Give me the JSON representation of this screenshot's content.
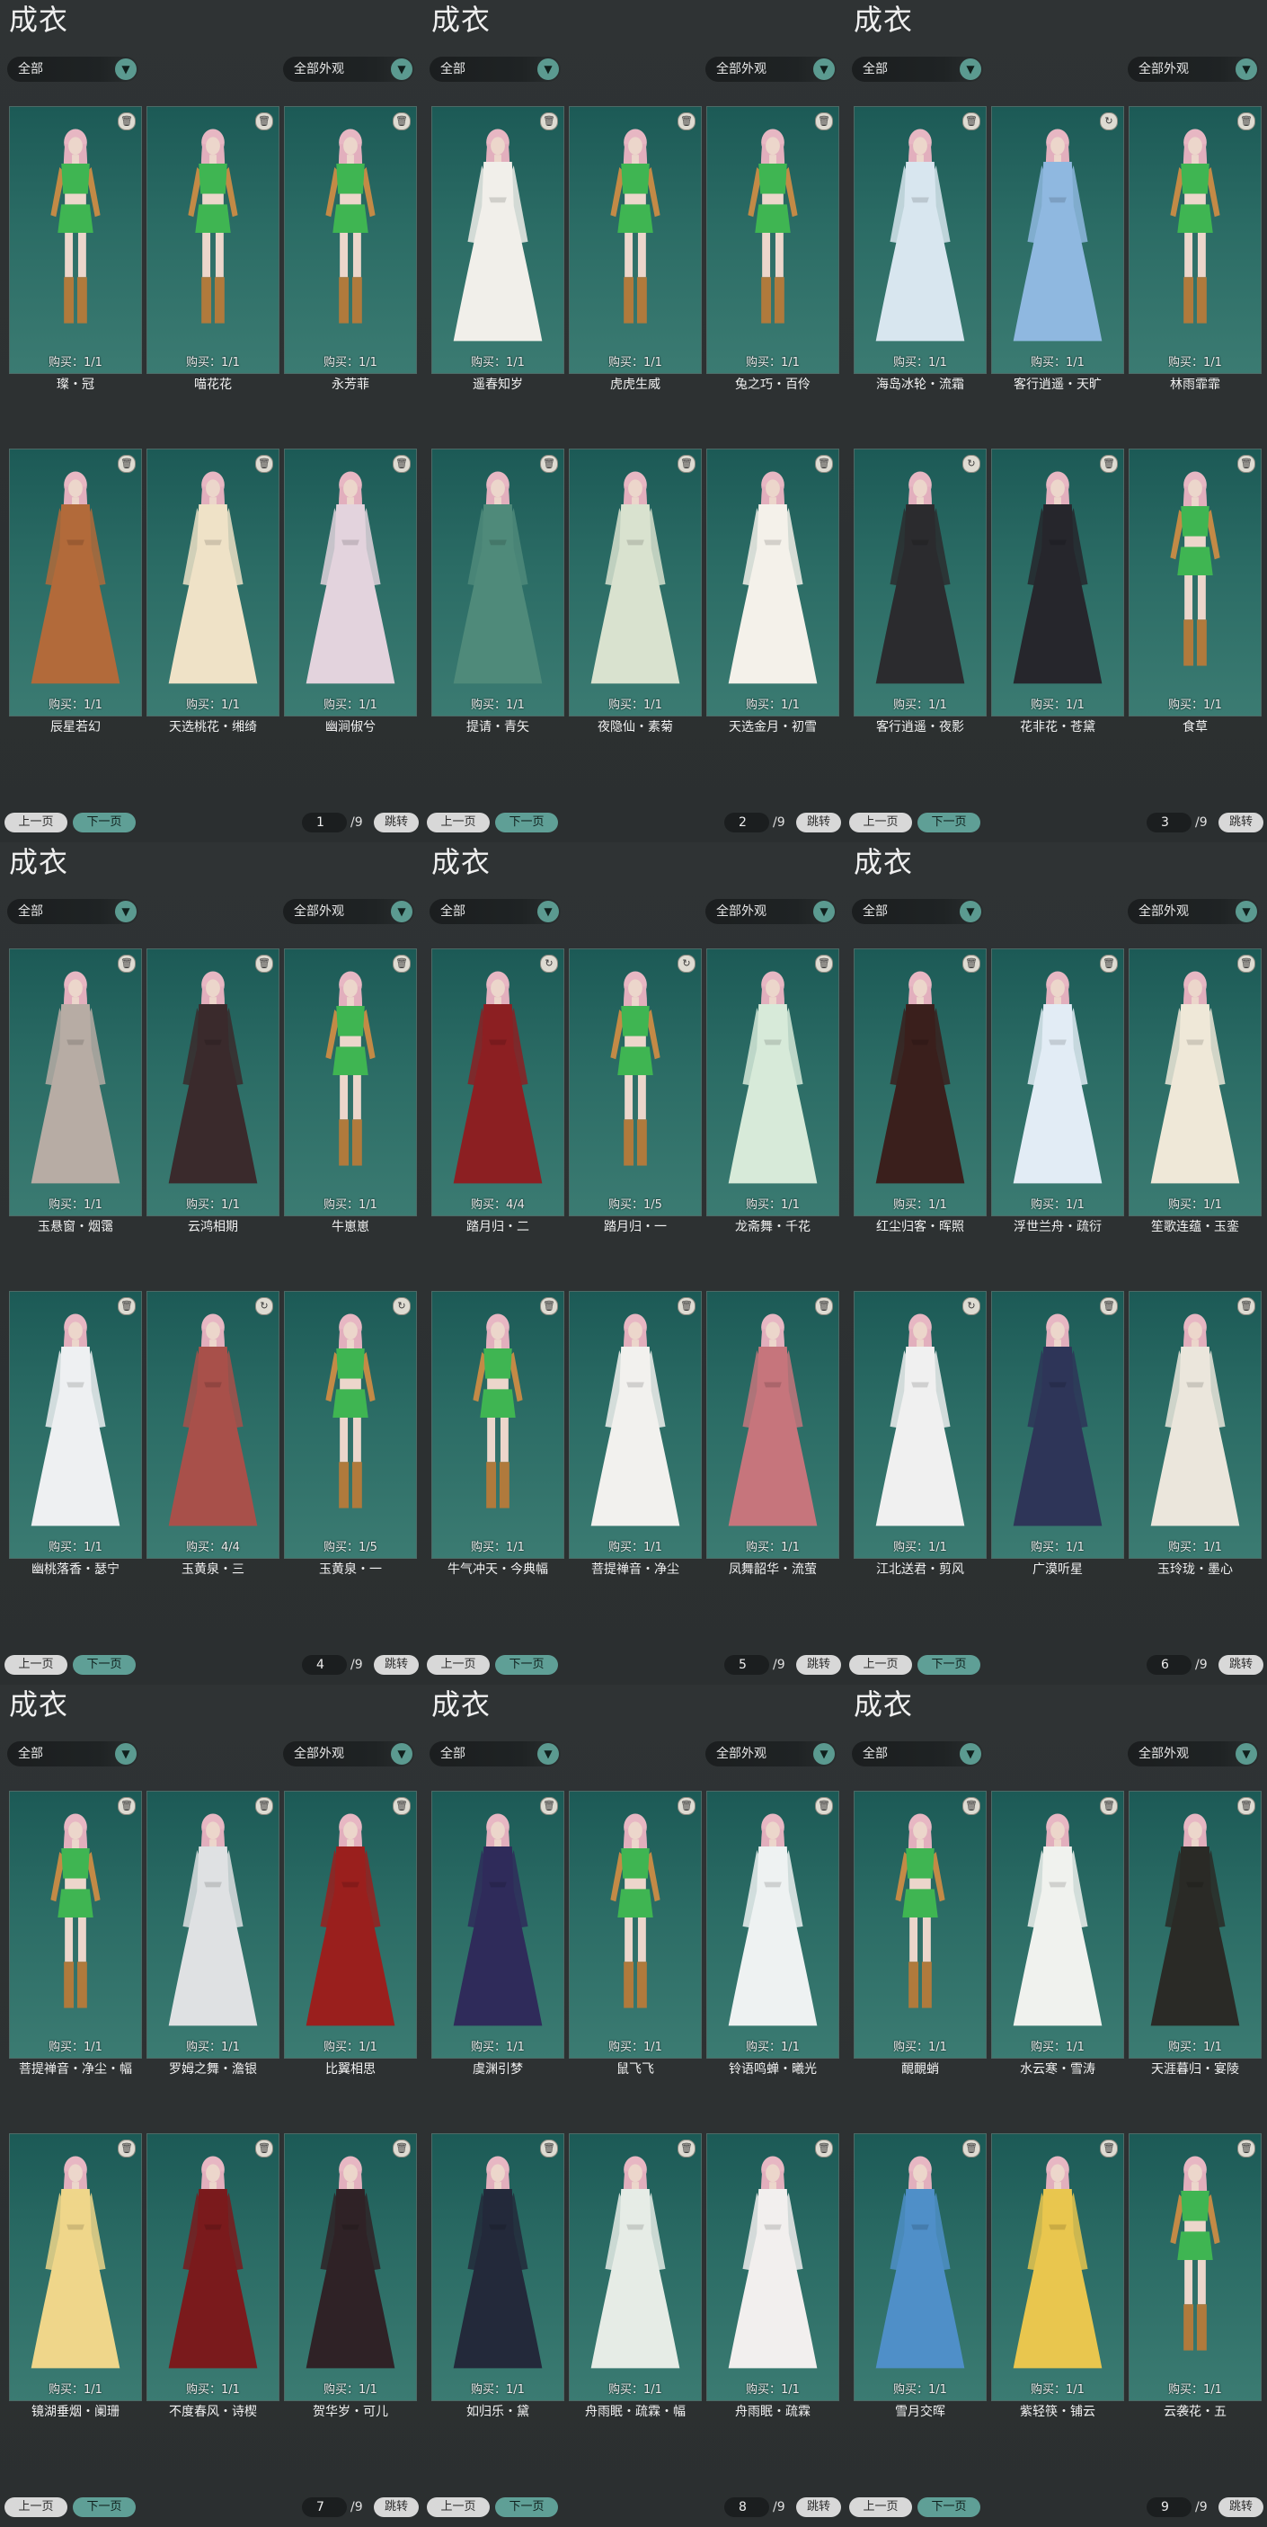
{
  "panels": [
    {
      "title": "成衣",
      "filter1": "全部",
      "filter2": "全部外观",
      "prev": "上一页",
      "next": "下一页",
      "page": "1",
      "total": "/9",
      "jump": "跳转",
      "items": [
        {
          "name": "璨・冠",
          "buy": "购买：1/1",
          "outfit": "green",
          "badge": "trash"
        },
        {
          "name": "喵花花",
          "buy": "购买：1/1",
          "outfit": "green",
          "badge": "trash"
        },
        {
          "name": "永芳菲",
          "buy": "购买：1/1",
          "outfit": "green",
          "badge": "trash"
        },
        {
          "name": "辰星若幻",
          "buy": "购买：1/1",
          "outfit": "#b26a3a",
          "badge": "trash"
        },
        {
          "name": "天选桃花・缃绮",
          "buy": "购买：1/1",
          "outfit": "#efe2c7",
          "badge": "trash"
        },
        {
          "name": "幽涧俶兮",
          "buy": "购买：1/1",
          "outfit": "#e3d3dd",
          "badge": "trash"
        }
      ]
    },
    {
      "title": "成衣",
      "filter1": "全部",
      "filter2": "全部外观",
      "prev": "上一页",
      "next": "下一页",
      "page": "2",
      "total": "/9",
      "jump": "跳转",
      "items": [
        {
          "name": "遥春知岁",
          "buy": "购买：1/1",
          "outfit": "#f1efea",
          "badge": "trash"
        },
        {
          "name": "虎虎生威",
          "buy": "购买：1/1",
          "outfit": "green",
          "badge": "trash"
        },
        {
          "name": "兔之巧・百伶",
          "buy": "购买：1/1",
          "outfit": "green",
          "badge": "trash"
        },
        {
          "name": "提请・青矢",
          "buy": "购买：1/1",
          "outfit": "#4f8a7a",
          "badge": "trash"
        },
        {
          "name": "夜隐仙・素菊",
          "buy": "购买：1/1",
          "outfit": "#d9e2cf",
          "badge": "trash"
        },
        {
          "name": "天选金月・初雪",
          "buy": "购买：1/1",
          "outfit": "#f4f1ea",
          "badge": "trash"
        }
      ]
    },
    {
      "title": "成衣",
      "filter1": "全部",
      "filter2": "全部外观",
      "prev": "上一页",
      "next": "下一页",
      "page": "3",
      "total": "/9",
      "jump": "跳转",
      "items": [
        {
          "name": "海岛冰轮・流霜",
          "buy": "购买：1/1",
          "outfit": "#d8e6ef",
          "badge": "trash"
        },
        {
          "name": "客行逍遥・天旷",
          "buy": "购买：1/1",
          "outfit": "#8fb8e0",
          "badge": "cycle"
        },
        {
          "name": "林雨霏霏",
          "buy": "购买：1/1",
          "outfit": "green",
          "badge": "trash"
        },
        {
          "name": "客行逍遥・夜影",
          "buy": "购买：1/1",
          "outfit": "#2b2b2e",
          "badge": "cycle"
        },
        {
          "name": "花非花・苍黛",
          "buy": "购买：1/1",
          "outfit": "#26262c",
          "badge": "trash"
        },
        {
          "name": "食草",
          "buy": "购买：1/1",
          "outfit": "green",
          "badge": "trash"
        }
      ]
    },
    {
      "title": "成衣",
      "filter1": "全部",
      "filter2": "全部外观",
      "prev": "上一页",
      "next": "下一页",
      "page": "4",
      "total": "/9",
      "jump": "跳转",
      "items": [
        {
          "name": "玉悬窗・烟霭",
          "buy": "购买：1/1",
          "outfit": "#b7aca4",
          "badge": "trash"
        },
        {
          "name": "云鸿相期",
          "buy": "购买：1/1",
          "outfit": "#3a2a2c",
          "badge": "trash"
        },
        {
          "name": "牛崽崽",
          "buy": "购买：1/1",
          "outfit": "green",
          "badge": "trash"
        },
        {
          "name": "幽桃落香・瑟宁",
          "buy": "购买：1/1",
          "outfit": "#eef0f2",
          "badge": "trash"
        },
        {
          "name": "玉黄泉・三",
          "buy": "购买：4/4",
          "outfit": "#a8504a",
          "badge": "cycle"
        },
        {
          "name": "玉黄泉・一",
          "buy": "购买：1/5",
          "outfit": "green",
          "badge": "cycle"
        }
      ]
    },
    {
      "title": "成衣",
      "filter1": "全部",
      "filter2": "全部外观",
      "prev": "上一页",
      "next": "下一页",
      "page": "5",
      "total": "/9",
      "jump": "跳转",
      "items": [
        {
          "name": "踏月归・二",
          "buy": "购买：4/4",
          "outfit": "#8c1f22",
          "badge": "cycle"
        },
        {
          "name": "踏月归・一",
          "buy": "购买：1/5",
          "outfit": "green",
          "badge": "cycle"
        },
        {
          "name": "龙斋舞・千花",
          "buy": "购买：1/1",
          "outfit": "#d7ead9",
          "badge": "trash"
        },
        {
          "name": "牛气冲天・今典幅",
          "buy": "购买：1/1",
          "outfit": "green",
          "badge": "trash"
        },
        {
          "name": "菩提禅音・净尘",
          "buy": "购买：1/1",
          "outfit": "#f2f1ee",
          "badge": "trash"
        },
        {
          "name": "凤舞韶华・流萤",
          "buy": "购买：1/1",
          "outfit": "#c6757c",
          "badge": "trash"
        }
      ]
    },
    {
      "title": "成衣",
      "filter1": "全部",
      "filter2": "全部外观",
      "prev": "上一页",
      "next": "下一页",
      "page": "6",
      "total": "/9",
      "jump": "跳转",
      "items": [
        {
          "name": "红尘归客・晖照",
          "buy": "购买：1/1",
          "outfit": "#3a1f1c",
          "badge": "trash"
        },
        {
          "name": "浮世兰舟・疏衍",
          "buy": "购买：1/1",
          "outfit": "#e2ecf5",
          "badge": "trash"
        },
        {
          "name": "笙歌连蕴・玉銮",
          "buy": "购买：1/1",
          "outfit": "#efe8d8",
          "badge": "trash"
        },
        {
          "name": "江北送君・剪风",
          "buy": "购买：1/1",
          "outfit": "#f0f0f0",
          "badge": "cycle"
        },
        {
          "name": "广漠听星",
          "buy": "购买：1/1",
          "outfit": "#2e3558",
          "badge": "trash"
        },
        {
          "name": "玉玲珑・墨心",
          "buy": "购买：1/1",
          "outfit": "#ebe6dc",
          "badge": "trash"
        }
      ]
    },
    {
      "title": "成衣",
      "filter1": "全部",
      "filter2": "全部外观",
      "prev": "上一页",
      "next": "下一页",
      "page": "7",
      "total": "/9",
      "jump": "跳转",
      "items": [
        {
          "name": "菩提禅音・净尘・幅",
          "buy": "购买：1/1",
          "outfit": "green",
          "badge": "trash"
        },
        {
          "name": "罗姆之舞・澹银",
          "buy": "购买：1/1",
          "outfit": "#dfe1e3",
          "badge": "trash"
        },
        {
          "name": "比翼相思",
          "buy": "购买：1/1",
          "outfit": "#9a1f1d",
          "badge": "trash"
        },
        {
          "name": "镜湖垂烟・阑珊",
          "buy": "购买：1/1",
          "outfit": "#efd68a",
          "badge": "trash"
        },
        {
          "name": "不度春风・诗楔",
          "buy": "购买：1/1",
          "outfit": "#7a1a1c",
          "badge": "trash"
        },
        {
          "name": "贺华岁・可儿",
          "buy": "购买：1/1",
          "outfit": "#2f2226",
          "badge": "trash"
        }
      ]
    },
    {
      "title": "成衣",
      "filter1": "全部",
      "filter2": "全部外观",
      "prev": "上一页",
      "next": "下一页",
      "page": "8",
      "total": "/9",
      "jump": "跳转",
      "items": [
        {
          "name": "虞渊引梦",
          "buy": "购买：1/1",
          "outfit": "#2f2b5a",
          "badge": "trash"
        },
        {
          "name": "鼠飞飞",
          "buy": "购买：1/1",
          "outfit": "green",
          "badge": "trash"
        },
        {
          "name": "铃语鸣蝉・曦光",
          "buy": "购买：1/1",
          "outfit": "#eef2f2",
          "badge": "trash"
        },
        {
          "name": "如归乐・黛",
          "buy": "购买：1/1",
          "outfit": "#23293a",
          "badge": "trash"
        },
        {
          "name": "舟雨眠・疏霖・幅",
          "buy": "购买：1/1",
          "outfit": "#e6ece6",
          "badge": "trash"
        },
        {
          "name": "舟雨眠・疏霖",
          "buy": "购买：1/1",
          "outfit": "#f2efee",
          "badge": "trash"
        }
      ]
    },
    {
      "title": "成衣",
      "filter1": "全部",
      "filter2": "全部外观",
      "prev": "上一页",
      "next": "下一页",
      "page": "9",
      "total": "/9",
      "jump": "跳转",
      "items": [
        {
          "name": "靦靦蛸",
          "buy": "购买：1/1",
          "outfit": "green",
          "badge": "trash"
        },
        {
          "name": "水云寒・雪涛",
          "buy": "购买：1/1",
          "outfit": "#f0f2ee",
          "badge": "trash"
        },
        {
          "name": "天涯暮归・宴陵",
          "buy": "购买：1/1",
          "outfit": "#2a2a26",
          "badge": "trash"
        },
        {
          "name": "雪月交晖",
          "buy": "购买：1/1",
          "outfit": "#4f8fc8",
          "badge": "trash"
        },
        {
          "name": "紫轻筷・铺云",
          "buy": "购买：1/1",
          "outfit": "#e9c64e",
          "badge": "trash"
        },
        {
          "name": "云袭花・五",
          "buy": "购买：1/1",
          "outfit": "green",
          "badge": "trash"
        }
      ]
    }
  ]
}
